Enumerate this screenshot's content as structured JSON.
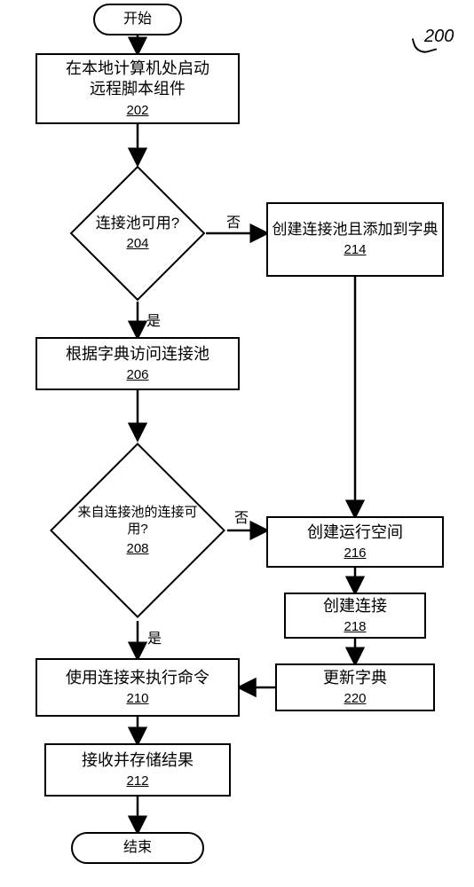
{
  "chart_data": {
    "type": "flowchart",
    "figure_label": "200",
    "nodes": [
      {
        "id": "start",
        "kind": "terminator",
        "text": "开始"
      },
      {
        "id": "202",
        "kind": "process",
        "text": "在本地计算机处启动\n远程脚本组件",
        "ref": "202"
      },
      {
        "id": "204",
        "kind": "decision",
        "text": "连接池可用?",
        "ref": "204"
      },
      {
        "id": "206",
        "kind": "process",
        "text": "根据字典访问连接池",
        "ref": "206"
      },
      {
        "id": "208",
        "kind": "decision",
        "text": "来自连接池的连接可用?",
        "ref": "208"
      },
      {
        "id": "210",
        "kind": "process",
        "text": "使用连接来执行命令",
        "ref": "210"
      },
      {
        "id": "212",
        "kind": "process",
        "text": "接收并存储结果",
        "ref": "212"
      },
      {
        "id": "214",
        "kind": "process",
        "text": "创建连接池且添加到字典",
        "ref": "214"
      },
      {
        "id": "216",
        "kind": "process",
        "text": "创建运行空间",
        "ref": "216"
      },
      {
        "id": "218",
        "kind": "process",
        "text": "创建连接",
        "ref": "218"
      },
      {
        "id": "220",
        "kind": "process",
        "text": "更新字典",
        "ref": "220"
      },
      {
        "id": "end",
        "kind": "terminator",
        "text": "结束"
      }
    ],
    "edges": [
      {
        "from": "start",
        "to": "202"
      },
      {
        "from": "202",
        "to": "204"
      },
      {
        "from": "204",
        "to": "206",
        "label": "是"
      },
      {
        "from": "204",
        "to": "214",
        "label": "否"
      },
      {
        "from": "206",
        "to": "208"
      },
      {
        "from": "214",
        "to": "216"
      },
      {
        "from": "208",
        "to": "210",
        "label": "是"
      },
      {
        "from": "208",
        "to": "216",
        "label": "否"
      },
      {
        "from": "216",
        "to": "218"
      },
      {
        "from": "218",
        "to": "220"
      },
      {
        "from": "220",
        "to": "210"
      },
      {
        "from": "210",
        "to": "212"
      },
      {
        "from": "212",
        "to": "end"
      }
    ]
  },
  "labels": {
    "yes": "是",
    "no": "否"
  }
}
